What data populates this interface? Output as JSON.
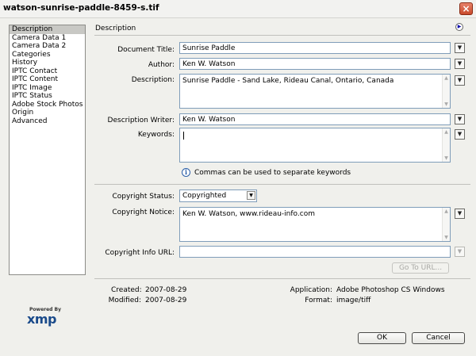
{
  "window": {
    "title": "watson-sunrise-paddle-8459-s.tif",
    "close_glyph": "×"
  },
  "nav": {
    "items": [
      {
        "label": "Description",
        "selected": true
      },
      {
        "label": "Camera Data 1"
      },
      {
        "label": "Camera Data 2"
      },
      {
        "label": "Categories"
      },
      {
        "label": "History"
      },
      {
        "label": "IPTC Contact"
      },
      {
        "label": "IPTC Content"
      },
      {
        "label": "IPTC Image"
      },
      {
        "label": "IPTC Status"
      },
      {
        "label": "Adobe Stock Photos"
      },
      {
        "label": "Origin"
      },
      {
        "label": "Advanced"
      }
    ]
  },
  "section": {
    "header": "Description",
    "menu_icon": "circle-arrow-icon"
  },
  "fields": {
    "document_title": {
      "label": "Document Title:",
      "value": "Sunrise Paddle"
    },
    "author": {
      "label": "Author:",
      "value": "Ken W. Watson"
    },
    "description": {
      "label": "Description:",
      "value": "Sunrise Paddle - Sand Lake, Rideau Canal, Ontario, Canada"
    },
    "description_writer": {
      "label": "Description Writer:",
      "value": "Ken W. Watson"
    },
    "keywords": {
      "label": "Keywords:",
      "value": ""
    },
    "keywords_hint": "Commas can be used to separate keywords",
    "copyright_status": {
      "label": "Copyright Status:",
      "value": "Copyrighted"
    },
    "copyright_notice": {
      "label": "Copyright Notice:",
      "value": "Ken W. Watson, www.rideau-info.com"
    },
    "copyright_url": {
      "label": "Copyright Info URL:",
      "value": ""
    },
    "goto_url_button": "Go To URL..."
  },
  "meta": {
    "created_label": "Created:",
    "created_value": "2007-08-29",
    "modified_label": "Modified:",
    "modified_value": "2007-08-29",
    "application_label": "Application:",
    "application_value": "Adobe Photoshop CS Windows",
    "format_label": "Format:",
    "format_value": "image/tiff"
  },
  "logo": {
    "powered_by": "Powered By",
    "name": "xmp"
  },
  "buttons": {
    "ok": "OK",
    "cancel": "Cancel"
  }
}
